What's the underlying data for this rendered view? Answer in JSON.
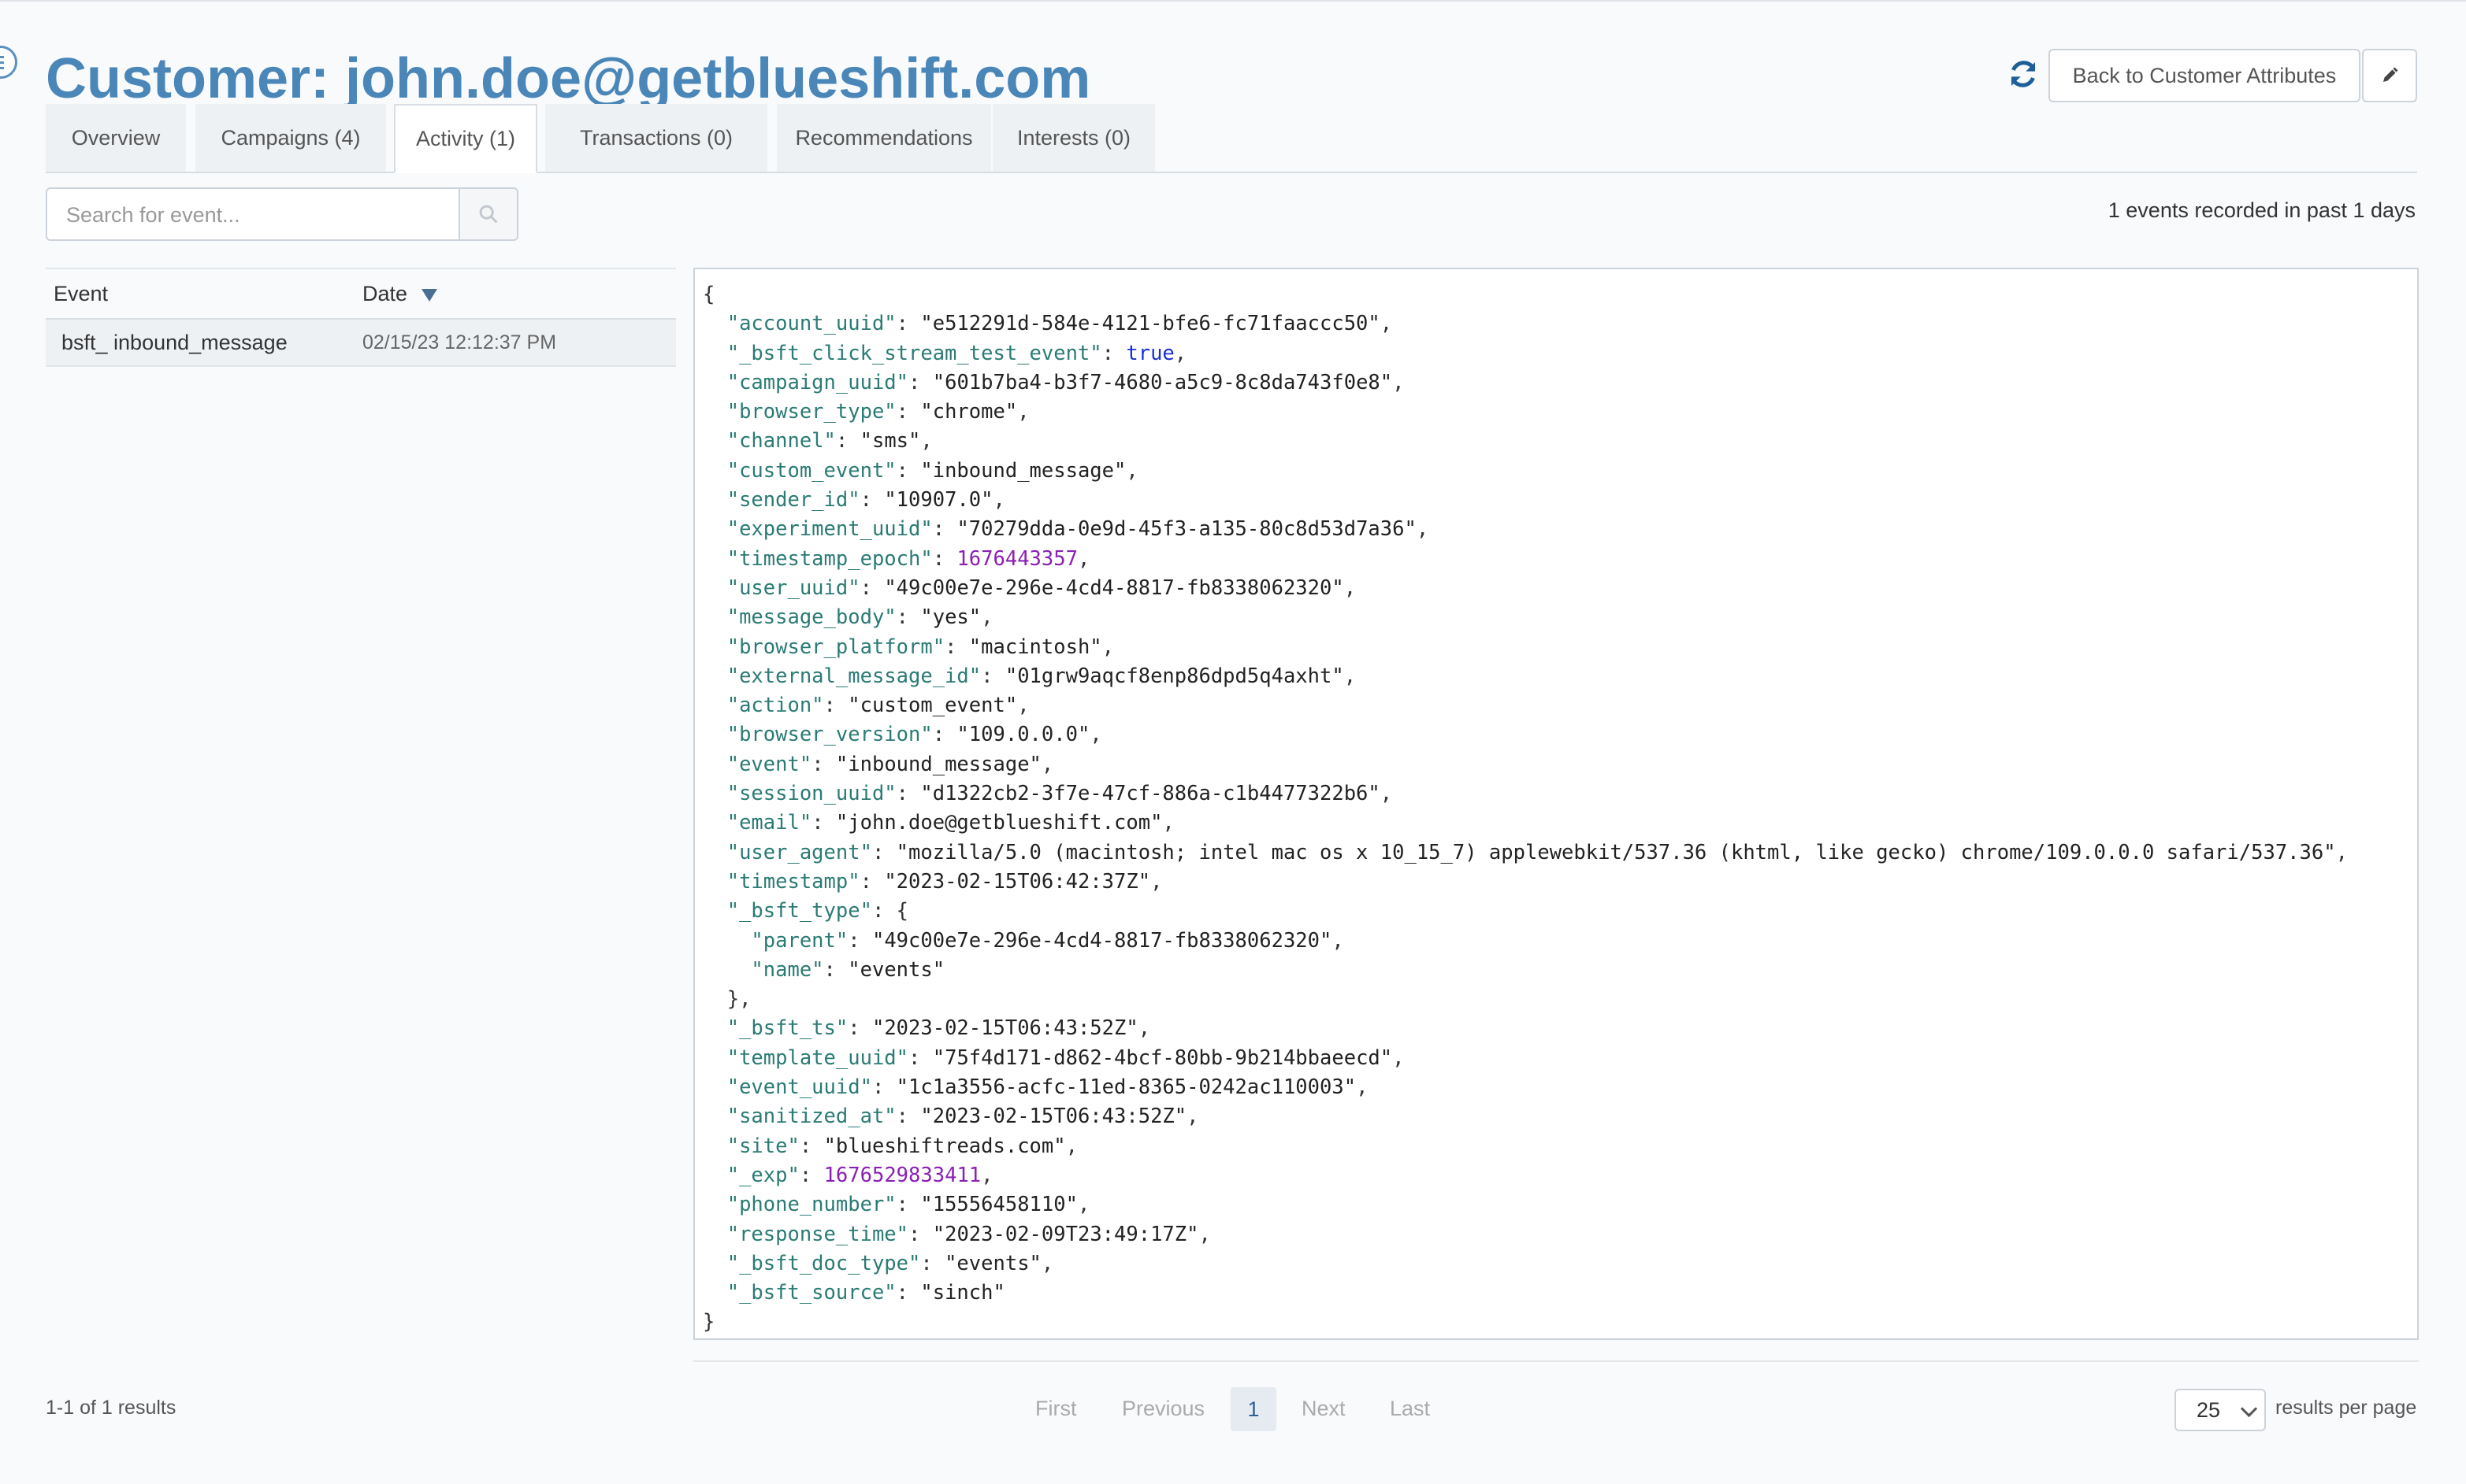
{
  "header": {
    "title": "Customer: john.doe@getblueshift.com",
    "back_label": "Back to Customer Attributes"
  },
  "tabs": [
    {
      "label": "Overview"
    },
    {
      "label": "Campaigns (4)"
    },
    {
      "label": "Activity (1)"
    },
    {
      "label": "Transactions (0)"
    },
    {
      "label": "Recommendations"
    },
    {
      "label": "Interests (0)"
    }
  ],
  "search": {
    "placeholder": "Search for event..."
  },
  "events_count": "1 events recorded in past 1 days",
  "table": {
    "col_event": "Event",
    "col_date": "Date",
    "rows": [
      {
        "event": "bsft_ inbound_message",
        "date": "02/15/23 12:12:37 PM"
      }
    ]
  },
  "json_lines": [
    {
      "t": "{"
    },
    {
      "i": 1,
      "k": "account_uuid",
      "v": "\"e512291d-584e-4121-bfe6-fc71faaccc50\"",
      "vt": "s",
      "c": true
    },
    {
      "i": 1,
      "k": "_bsft_click_stream_test_event",
      "v": "true",
      "vt": "b",
      "c": true
    },
    {
      "i": 1,
      "k": "campaign_uuid",
      "v": "\"601b7ba4-b3f7-4680-a5c9-8c8da743f0e8\"",
      "vt": "s",
      "c": true
    },
    {
      "i": 1,
      "k": "browser_type",
      "v": "\"chrome\"",
      "vt": "s",
      "c": true
    },
    {
      "i": 1,
      "k": "channel",
      "v": "\"sms\"",
      "vt": "s",
      "c": true
    },
    {
      "i": 1,
      "k": "custom_event",
      "v": "\"inbound_message\"",
      "vt": "s",
      "c": true
    },
    {
      "i": 1,
      "k": "sender_id",
      "v": "\"10907.0\"",
      "vt": "s",
      "c": true
    },
    {
      "i": 1,
      "k": "experiment_uuid",
      "v": "\"70279dda-0e9d-45f3-a135-80c8d53d7a36\"",
      "vt": "s",
      "c": true
    },
    {
      "i": 1,
      "k": "timestamp_epoch",
      "v": "1676443357",
      "vt": "n",
      "c": true
    },
    {
      "i": 1,
      "k": "user_uuid",
      "v": "\"49c00e7e-296e-4cd4-8817-fb8338062320\"",
      "vt": "s",
      "c": true
    },
    {
      "i": 1,
      "k": "message_body",
      "v": "\"yes\"",
      "vt": "s",
      "c": true
    },
    {
      "i": 1,
      "k": "browser_platform",
      "v": "\"macintosh\"",
      "vt": "s",
      "c": true
    },
    {
      "i": 1,
      "k": "external_message_id",
      "v": "\"01grw9aqcf8enp86dpd5q4axht\"",
      "vt": "s",
      "c": true
    },
    {
      "i": 1,
      "k": "action",
      "v": "\"custom_event\"",
      "vt": "s",
      "c": true
    },
    {
      "i": 1,
      "k": "browser_version",
      "v": "\"109.0.0.0\"",
      "vt": "s",
      "c": true
    },
    {
      "i": 1,
      "k": "event",
      "v": "\"inbound_message\"",
      "vt": "s",
      "c": true
    },
    {
      "i": 1,
      "k": "session_uuid",
      "v": "\"d1322cb2-3f7e-47cf-886a-c1b4477322b6\"",
      "vt": "s",
      "c": true
    },
    {
      "i": 1,
      "k": "email",
      "v": "\"john.doe@getblueshift.com\"",
      "vt": "s",
      "c": true
    },
    {
      "i": 1,
      "k": "user_agent",
      "v": "\"mozilla/5.0 (macintosh; intel mac os x 10_15_7) applewebkit/537.36 (khtml, like gecko) chrome/109.0.0.0 safari/537.36\"",
      "vt": "s",
      "c": true
    },
    {
      "i": 1,
      "k": "timestamp",
      "v": "\"2023-02-15T06:42:37Z\"",
      "vt": "s",
      "c": true
    },
    {
      "i": 1,
      "k": "_bsft_type",
      "v": "{",
      "vt": "p",
      "c": false
    },
    {
      "i": 2,
      "k": "parent",
      "v": "\"49c00e7e-296e-4cd4-8817-fb8338062320\"",
      "vt": "s",
      "c": true
    },
    {
      "i": 2,
      "k": "name",
      "v": "\"events\"",
      "vt": "s",
      "c": false
    },
    {
      "i": 1,
      "t": "},"
    },
    {
      "i": 1,
      "k": "_bsft_ts",
      "v": "\"2023-02-15T06:43:52Z\"",
      "vt": "s",
      "c": true
    },
    {
      "i": 1,
      "k": "template_uuid",
      "v": "\"75f4d171-d862-4bcf-80bb-9b214bbaeecd\"",
      "vt": "s",
      "c": true
    },
    {
      "i": 1,
      "k": "event_uuid",
      "v": "\"1c1a3556-acfc-11ed-8365-0242ac110003\"",
      "vt": "s",
      "c": true
    },
    {
      "i": 1,
      "k": "sanitized_at",
      "v": "\"2023-02-15T06:43:52Z\"",
      "vt": "s",
      "c": true
    },
    {
      "i": 1,
      "k": "site",
      "v": "\"blueshiftreads.com\"",
      "vt": "s",
      "c": true
    },
    {
      "i": 1,
      "k": "_exp",
      "v": "1676529833411",
      "vt": "n",
      "c": true
    },
    {
      "i": 1,
      "k": "phone_number",
      "v": "\"15556458110\"",
      "vt": "s",
      "c": true
    },
    {
      "i": 1,
      "k": "response_time",
      "v": "\"2023-02-09T23:49:17Z\"",
      "vt": "s",
      "c": true
    },
    {
      "i": 1,
      "k": "_bsft_doc_type",
      "v": "\"events\"",
      "vt": "s",
      "c": true
    },
    {
      "i": 1,
      "k": "_bsft_source",
      "v": "\"sinch\"",
      "vt": "s",
      "c": false
    },
    {
      "t": "}"
    }
  ],
  "footer": {
    "results_range": "1-1 of 1 results",
    "pager": {
      "first": "First",
      "previous": "Previous",
      "current": "1",
      "next": "Next",
      "last": "Last"
    },
    "per_page_value": "25",
    "per_page_label": "results per page"
  },
  "colors": {
    "title": "#4a86b8",
    "json_key": "#2a7b74",
    "json_number": "#8a1fb4",
    "json_bool": "#1a2fd6"
  },
  "icons": [
    "menu-icon",
    "refresh-icon",
    "pencil-icon",
    "search-icon",
    "sort-desc-icon",
    "chevron-down-icon"
  ]
}
